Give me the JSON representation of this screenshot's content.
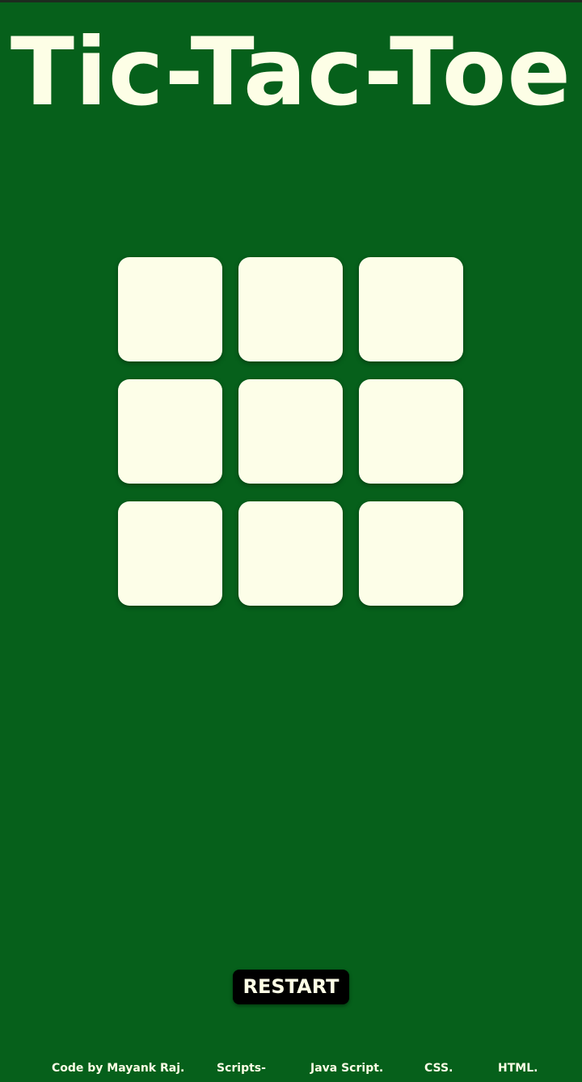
{
  "title": "Tic-Tac-Toe",
  "board": {
    "cells": [
      "",
      "",
      "",
      "",
      "",
      "",
      "",
      "",
      ""
    ]
  },
  "restart_label": "RESTART",
  "footer": {
    "credit": "Code by Mayank Raj.",
    "scripts": "Scripts-",
    "js": "Java Script.",
    "css": "CSS.",
    "html": "HTML."
  },
  "colors": {
    "background": "#06601b",
    "cell": "#fdfee8",
    "text": "#fdfee6",
    "button": "#000000"
  }
}
